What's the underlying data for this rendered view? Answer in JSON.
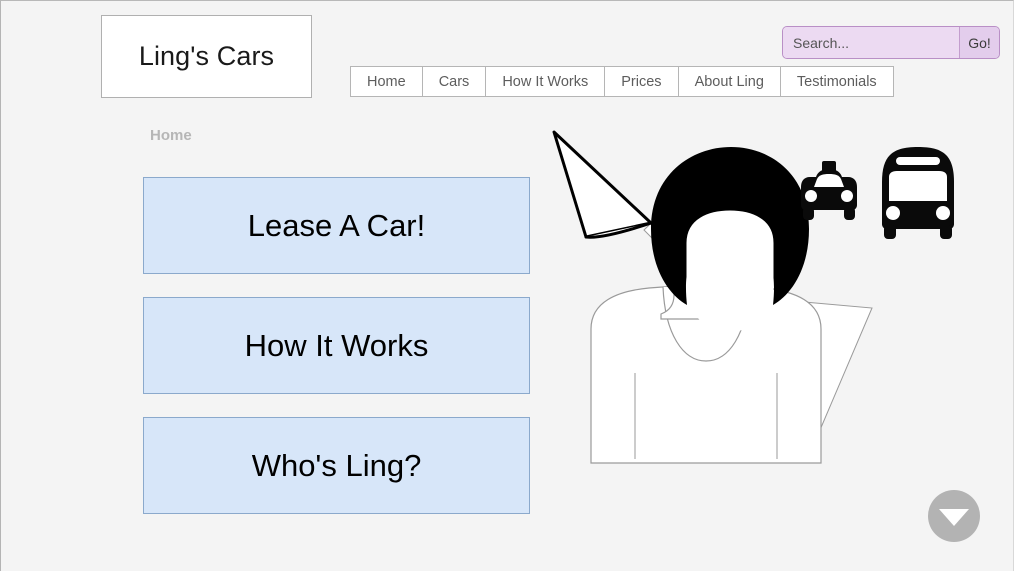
{
  "site": {
    "logo_text": "Ling's Cars",
    "background_color": "#f4f4f4"
  },
  "search": {
    "placeholder": "Search...",
    "value": "",
    "button_label": "Go!",
    "field_color": "#ecdaf2",
    "border_color": "#b98fc6"
  },
  "nav": {
    "items": [
      {
        "label": "Home"
      },
      {
        "label": "Cars"
      },
      {
        "label": "How It Works"
      },
      {
        "label": "Prices"
      },
      {
        "label": "About Ling"
      },
      {
        "label": "Testimonials"
      }
    ]
  },
  "breadcrumb": {
    "label": "Home"
  },
  "main": {
    "buttons": [
      {
        "label": "Lease A Car!"
      },
      {
        "label": "How It Works"
      },
      {
        "label": "Who's Ling?"
      }
    ],
    "button_color": "#d7e6f9",
    "button_border_color": "#8ba9cc"
  },
  "illustration": {
    "arrow_name": "double-headed-diagonal-arrow",
    "person_name": "person-silhouette",
    "vehicles": [
      {
        "name": "taxi-icon"
      },
      {
        "name": "bus-icon"
      }
    ]
  },
  "scroll_button": {
    "name": "scroll-down-button",
    "glyph": "▼",
    "color": "#b3b3b3"
  }
}
